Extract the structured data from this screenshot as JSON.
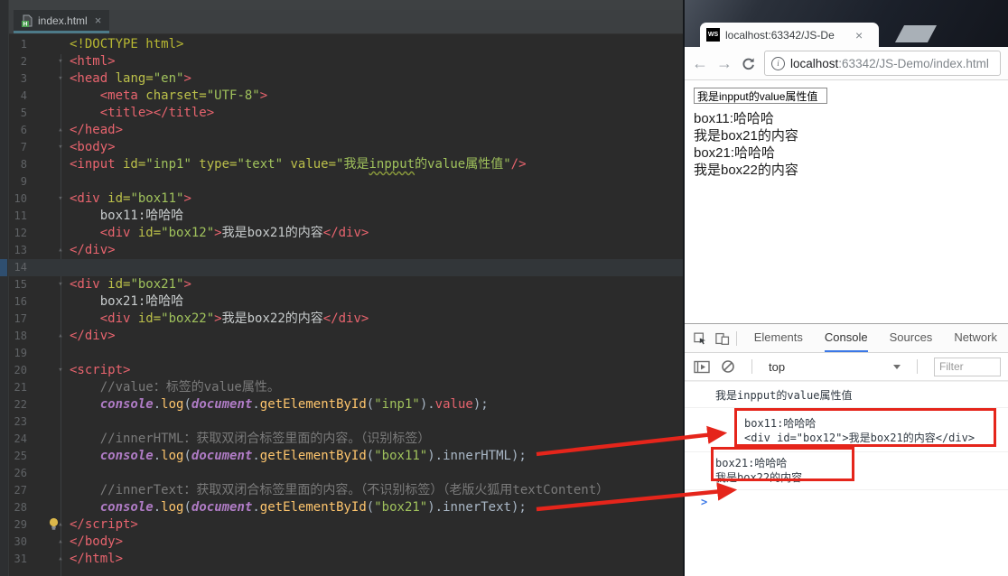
{
  "colors": {
    "annotation_red": "#e5251b",
    "devtools_active_blue": "#3b78e7",
    "editor_tab_underline": "#4d7a88"
  },
  "editor": {
    "tab": {
      "title": "index.html",
      "close": "×"
    },
    "lines": [
      {
        "n": "1",
        "tokens": [
          [
            "doctype",
            "<!DOCTYPE html>"
          ]
        ]
      },
      {
        "n": "2",
        "fold": "o",
        "tokens": [
          [
            "tag",
            "<html>"
          ]
        ]
      },
      {
        "n": "3",
        "fold": "o",
        "tokens": [
          [
            "tag",
            "<head"
          ],
          [
            "attr",
            " lang="
          ],
          [
            "str",
            "\"en\""
          ],
          [
            "tag",
            ">"
          ]
        ]
      },
      {
        "n": "4",
        "tokens": [
          [
            "plain",
            "    "
          ],
          [
            "tag",
            "<meta"
          ],
          [
            "attr",
            " charset="
          ],
          [
            "str",
            "\"UTF-8\""
          ],
          [
            "tag",
            ">"
          ]
        ]
      },
      {
        "n": "5",
        "tokens": [
          [
            "plain",
            "    "
          ],
          [
            "tag",
            "<title></title>"
          ]
        ]
      },
      {
        "n": "6",
        "fold": "c",
        "tokens": [
          [
            "tag",
            "</head>"
          ]
        ]
      },
      {
        "n": "7",
        "fold": "o",
        "tokens": [
          [
            "tag",
            "<body>"
          ]
        ]
      },
      {
        "n": "8",
        "tokens": [
          [
            "tag",
            "<input"
          ],
          [
            "attr",
            " id="
          ],
          [
            "str",
            "\"inp1\""
          ],
          [
            "attr",
            " type="
          ],
          [
            "str",
            "\"text\""
          ],
          [
            "attr",
            " value="
          ],
          [
            "str",
            "\"我是"
          ],
          [
            "typo",
            "inpput"
          ],
          [
            "str",
            "的value属性值\""
          ],
          [
            "tag",
            "/>"
          ]
        ]
      },
      {
        "n": "9",
        "tokens": []
      },
      {
        "n": "10",
        "fold": "o",
        "tokens": [
          [
            "tag",
            "<div"
          ],
          [
            "attr",
            " id="
          ],
          [
            "str",
            "\"box11\""
          ],
          [
            "tag",
            ">"
          ]
        ]
      },
      {
        "n": "11",
        "tokens": [
          [
            "text",
            "    box11:哈哈哈"
          ]
        ]
      },
      {
        "n": "12",
        "tokens": [
          [
            "plain",
            "    "
          ],
          [
            "tag",
            "<div"
          ],
          [
            "attr",
            " id="
          ],
          [
            "str",
            "\"box12\""
          ],
          [
            "tag",
            ">"
          ],
          [
            "text",
            "我是box21的内容"
          ],
          [
            "tag",
            "</div>"
          ]
        ]
      },
      {
        "n": "13",
        "fold": "c",
        "tokens": [
          [
            "tag",
            "</div>"
          ]
        ]
      },
      {
        "n": "14",
        "cur": true,
        "tokens": []
      },
      {
        "n": "15",
        "fold": "o",
        "tokens": [
          [
            "tag",
            "<div"
          ],
          [
            "attr",
            " id="
          ],
          [
            "str",
            "\"box21\""
          ],
          [
            "tag",
            ">"
          ]
        ]
      },
      {
        "n": "16",
        "tokens": [
          [
            "text",
            "    box21:哈哈哈"
          ]
        ]
      },
      {
        "n": "17",
        "tokens": [
          [
            "plain",
            "    "
          ],
          [
            "tag",
            "<div"
          ],
          [
            "attr",
            " id="
          ],
          [
            "str",
            "\"box22\""
          ],
          [
            "tag",
            ">"
          ],
          [
            "text",
            "我是box22的内容"
          ],
          [
            "tag",
            "</div>"
          ]
        ]
      },
      {
        "n": "18",
        "fold": "c",
        "tokens": [
          [
            "tag",
            "</div>"
          ]
        ]
      },
      {
        "n": "19",
        "tokens": []
      },
      {
        "n": "20",
        "fold": "o",
        "tokens": [
          [
            "tag",
            "<script>"
          ]
        ]
      },
      {
        "n": "21",
        "tokens": [
          [
            "cmt",
            "    //value：标签的value属性。"
          ]
        ]
      },
      {
        "n": "22",
        "tokens": [
          [
            "plain",
            "    "
          ],
          [
            "kw",
            "console"
          ],
          [
            "plain",
            "."
          ],
          [
            "fn",
            "log"
          ],
          [
            "plain",
            "("
          ],
          [
            "kw",
            "document"
          ],
          [
            "plain",
            "."
          ],
          [
            "fn",
            "getElementById"
          ],
          [
            "plain",
            "("
          ],
          [
            "str",
            "\"inp1\""
          ],
          [
            "plain",
            ")."
          ],
          [
            "prop",
            "value"
          ],
          [
            "plain",
            ");"
          ]
        ]
      },
      {
        "n": "23",
        "tokens": []
      },
      {
        "n": "24",
        "tokens": [
          [
            "cmt",
            "    //innerHTML：获取双闭合标签里面的内容。（识别标签）"
          ]
        ]
      },
      {
        "n": "25",
        "tokens": [
          [
            "plain",
            "    "
          ],
          [
            "kw",
            "console"
          ],
          [
            "plain",
            "."
          ],
          [
            "fn",
            "log"
          ],
          [
            "plain",
            "("
          ],
          [
            "kw",
            "document"
          ],
          [
            "plain",
            "."
          ],
          [
            "fn",
            "getElementById"
          ],
          [
            "plain",
            "("
          ],
          [
            "str",
            "\"box11\""
          ],
          [
            "plain",
            ").innerHTML);"
          ]
        ]
      },
      {
        "n": "26",
        "tokens": []
      },
      {
        "n": "27",
        "bulb": true,
        "tokens": [
          [
            "cmt",
            "    //innerText：获取双闭合标签里面的内容。（不识别标签）（老版火狐用textContent）"
          ]
        ]
      },
      {
        "n": "28",
        "tokens": [
          [
            "plain",
            "    "
          ],
          [
            "kw",
            "console"
          ],
          [
            "plain",
            "."
          ],
          [
            "fn",
            "log"
          ],
          [
            "plain",
            "("
          ],
          [
            "kw",
            "document"
          ],
          [
            "plain",
            "."
          ],
          [
            "fn",
            "getElementById"
          ],
          [
            "plain",
            "("
          ],
          [
            "str",
            "\"box21\""
          ],
          [
            "plain",
            ").innerText);"
          ]
        ]
      },
      {
        "n": "29",
        "fold": "c",
        "tokens": [
          [
            "tag",
            "</script>"
          ]
        ]
      },
      {
        "n": "30",
        "fold": "c",
        "tokens": [
          [
            "tag",
            "</body>"
          ]
        ]
      },
      {
        "n": "31",
        "fold": "c",
        "tokens": [
          [
            "tag",
            "</html>"
          ]
        ]
      }
    ]
  },
  "browser": {
    "tab": {
      "favicon": "WS",
      "title": "localhost:63342/JS-De",
      "close": "×"
    },
    "nav": {
      "back": "←",
      "forward": "→"
    },
    "address": {
      "info": "i",
      "host": "localhost",
      "path": ":63342/JS-Demo/index.html"
    },
    "page": {
      "input_value": "我是inpput的value属性值",
      "lines": [
        "box11:哈哈哈",
        "我是box21的内容",
        "box21:哈哈哈",
        "我是box22的内容"
      ]
    }
  },
  "devtools": {
    "tabs": [
      {
        "label": "Elements",
        "active": false
      },
      {
        "label": "Console",
        "active": true
      },
      {
        "label": "Sources",
        "active": false
      },
      {
        "label": "Network",
        "active": false
      }
    ],
    "context": "top",
    "filter_placeholder": "Filter",
    "console": [
      {
        "lines": [
          "我是inpput的value属性值"
        ],
        "indent": false
      },
      {
        "lines": [
          "box11:哈哈哈",
          "<div id=\"box12\">我是box21的内容</div>"
        ],
        "indent": true
      },
      {
        "lines": [
          "box21:哈哈哈",
          "我是box22的内容"
        ],
        "indent": false
      }
    ],
    "prompt": ">"
  }
}
